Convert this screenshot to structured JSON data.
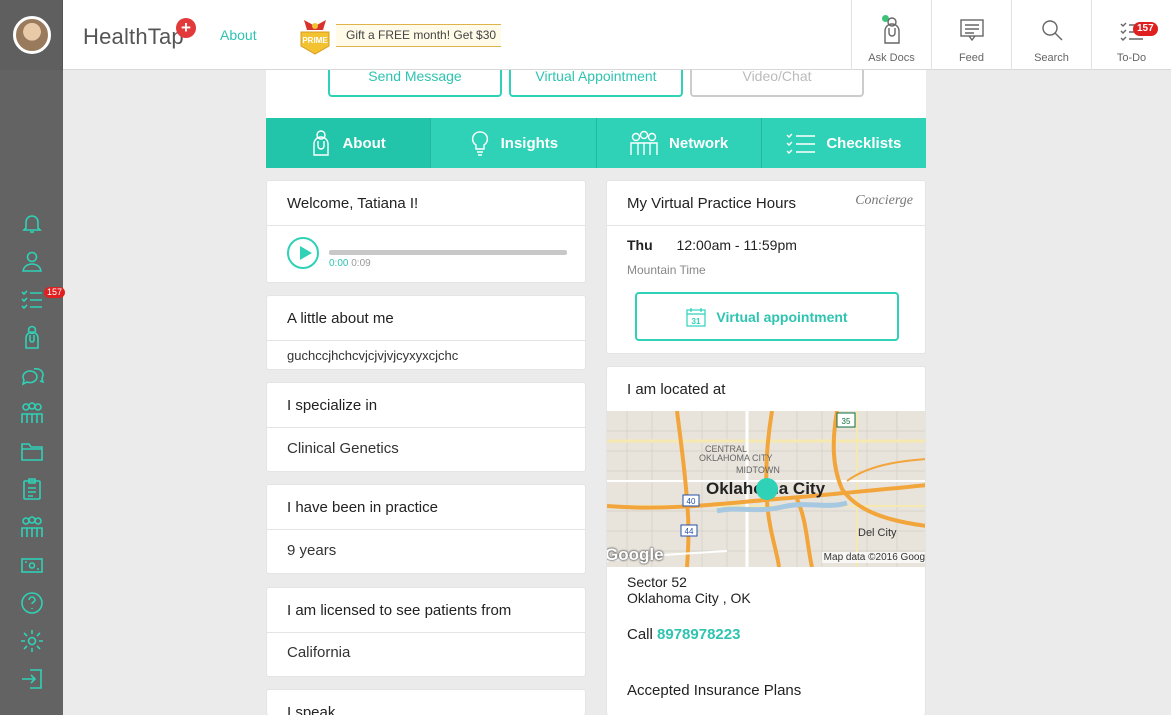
{
  "header": {
    "logo": "HealthTap",
    "nav_about": "About",
    "promo": "Gift a FREE month! Get $30",
    "prime_label": "PRIME",
    "buttons": [
      {
        "label": "Ask Docs",
        "icon": "doctor-icon"
      },
      {
        "label": "Feed",
        "icon": "feed-icon"
      },
      {
        "label": "Search",
        "icon": "search-icon"
      },
      {
        "label": "To-Do",
        "icon": "checklist-icon",
        "badge": "157"
      }
    ]
  },
  "sidebar": {
    "todo_badge": "157"
  },
  "actions": {
    "send_message": "Send Message",
    "virtual_appointment": "Virtual Appointment",
    "video_chat": "Video/Chat"
  },
  "tabs": [
    {
      "label": "About",
      "icon": "doctor-icon"
    },
    {
      "label": "Insights",
      "icon": "lightbulb-icon"
    },
    {
      "label": "Network",
      "icon": "people-icon"
    },
    {
      "label": "Checklists",
      "icon": "checklist-icon"
    }
  ],
  "left": {
    "welcome": "Welcome, Tatiana I!",
    "audio_current": "0:00",
    "audio_total": "0:09",
    "about_title": "A little about me",
    "about_text": "guchccjhchcvjcjvjvjcyxyxcjchc",
    "specialize_title": "I specialize in",
    "specialize_value": "Clinical Genetics",
    "practice_title": "I have been in practice",
    "practice_value": "9 years",
    "licensed_title": "I am licensed to see patients from",
    "licensed_value": "California",
    "speak_title": "I speak"
  },
  "right": {
    "hours_title": "My Virtual Practice Hours",
    "concierge": "Concierge",
    "day": "Thu",
    "hours": "12:00am - 11:59pm",
    "timezone": "Mountain Time",
    "virtual_button": "Virtual appointment",
    "calendar_num": "31",
    "location_title": "I am located at",
    "map": {
      "city": "Oklahoma City",
      "central": "CENTRAL",
      "oklahoma_city_small": "OKLAHOMA CITY",
      "midtown": "MIDTOWN",
      "del_city": "Del City",
      "hwy35": "35",
      "hwy40": "40",
      "hwy44": "44",
      "google": "Google",
      "map_data": "Map data ©2016 Goog"
    },
    "address_line1": "Sector 52",
    "address_line2": "Oklahoma City , OK",
    "call_label": "Call",
    "phone": "8978978223",
    "insurance_title": "Accepted Insurance Plans"
  },
  "colors": {
    "accent": "#2fd1b7",
    "rail": "#636363",
    "badge": "#e02020"
  }
}
